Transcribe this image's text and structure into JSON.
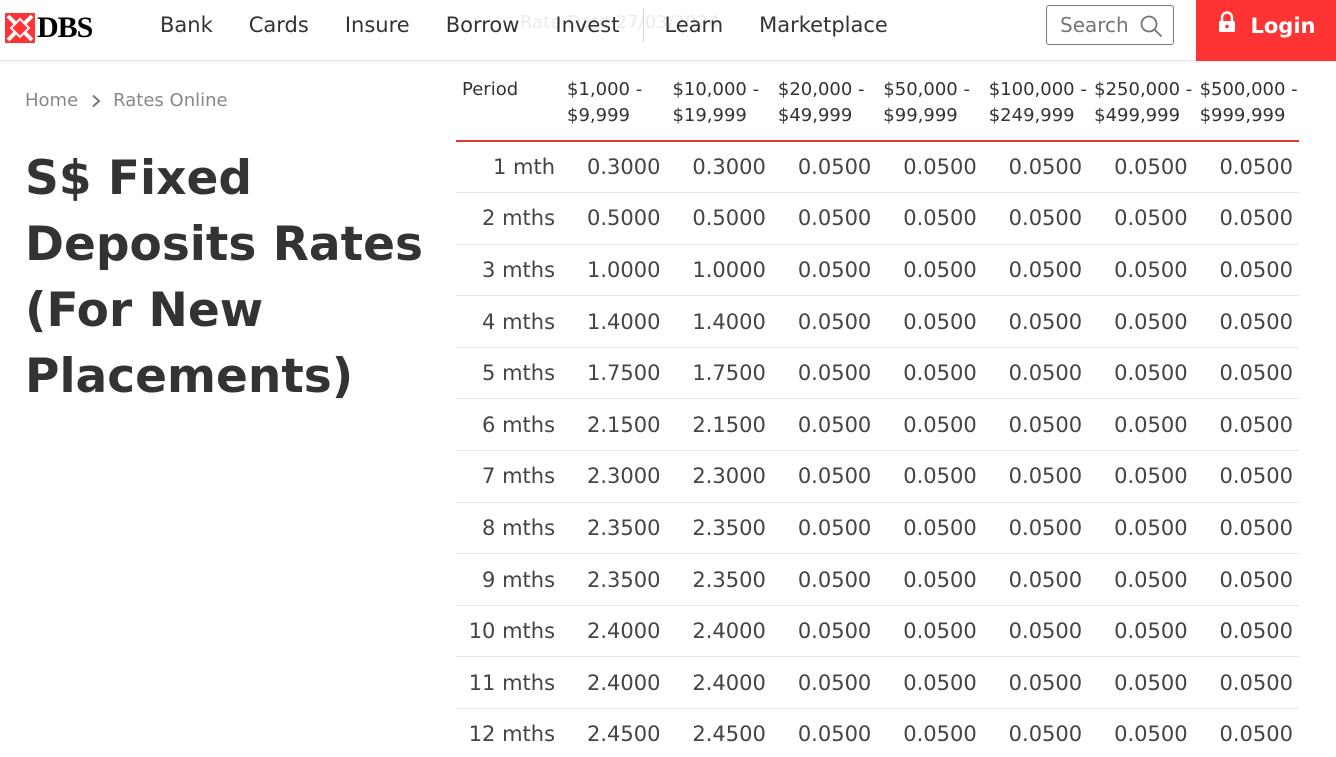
{
  "header": {
    "logo_text": "DBS",
    "nav": [
      "Bank",
      "Cards",
      "Insure",
      "Borrow",
      "Invest",
      "Learn",
      "Marketplace"
    ],
    "search_placeholder": "Search",
    "login_label": "Login",
    "ghost_text": "Rate Date 27/03/2024"
  },
  "breadcrumb": {
    "home": "Home",
    "current": "Rates Online"
  },
  "page_title": "S$ Fixed Deposits Rates (For New Placements)",
  "table": {
    "headers": [
      "Period",
      "$1,000 - $9,999",
      "$10,000 - $19,999",
      "$20,000 - $49,999",
      "$50,000 - $99,999",
      "$100,000 - $249,999",
      "$250,000 - $499,999",
      "$500,000 - $999,999"
    ],
    "rows": [
      [
        "1 mth",
        "0.3000",
        "0.3000",
        "0.0500",
        "0.0500",
        "0.0500",
        "0.0500",
        "0.0500"
      ],
      [
        "2 mths",
        "0.5000",
        "0.5000",
        "0.0500",
        "0.0500",
        "0.0500",
        "0.0500",
        "0.0500"
      ],
      [
        "3 mths",
        "1.0000",
        "1.0000",
        "0.0500",
        "0.0500",
        "0.0500",
        "0.0500",
        "0.0500"
      ],
      [
        "4 mths",
        "1.4000",
        "1.4000",
        "0.0500",
        "0.0500",
        "0.0500",
        "0.0500",
        "0.0500"
      ],
      [
        "5 mths",
        "1.7500",
        "1.7500",
        "0.0500",
        "0.0500",
        "0.0500",
        "0.0500",
        "0.0500"
      ],
      [
        "6 mths",
        "2.1500",
        "2.1500",
        "0.0500",
        "0.0500",
        "0.0500",
        "0.0500",
        "0.0500"
      ],
      [
        "7 mths",
        "2.3000",
        "2.3000",
        "0.0500",
        "0.0500",
        "0.0500",
        "0.0500",
        "0.0500"
      ],
      [
        "8 mths",
        "2.3500",
        "2.3500",
        "0.0500",
        "0.0500",
        "0.0500",
        "0.0500",
        "0.0500"
      ],
      [
        "9 mths",
        "2.3500",
        "2.3500",
        "0.0500",
        "0.0500",
        "0.0500",
        "0.0500",
        "0.0500"
      ],
      [
        "10 mths",
        "2.4000",
        "2.4000",
        "0.0500",
        "0.0500",
        "0.0500",
        "0.0500",
        "0.0500"
      ],
      [
        "11 mths",
        "2.4000",
        "2.4000",
        "0.0500",
        "0.0500",
        "0.0500",
        "0.0500",
        "0.0500"
      ],
      [
        "12 mths",
        "2.4500",
        "2.4500",
        "0.0500",
        "0.0500",
        "0.0500",
        "0.0500",
        "0.0500"
      ]
    ]
  },
  "colors": {
    "brand_red": "#ff3333",
    "table_header_rule": "#e53935",
    "text": "#333333",
    "muted": "#888888"
  },
  "icons": [
    "dbs-logo-icon",
    "search-icon",
    "lock-icon",
    "chevron-right-icon"
  ]
}
